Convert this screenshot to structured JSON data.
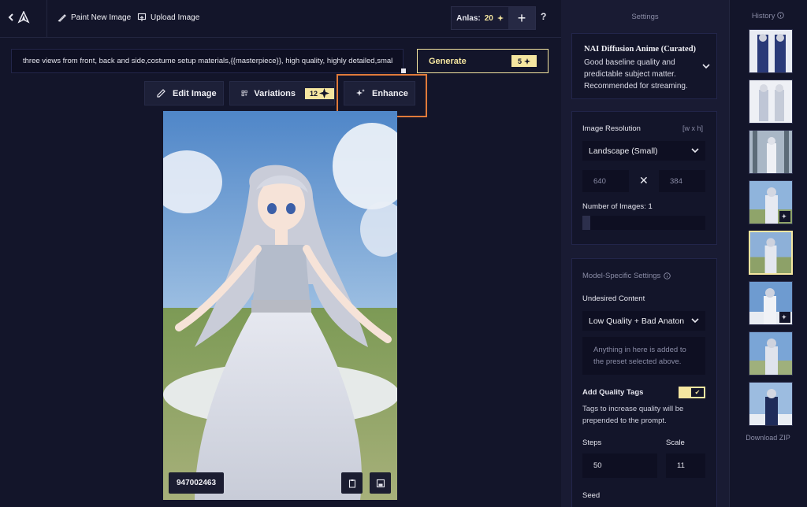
{
  "topbar": {
    "paint_label": "Paint New Image",
    "upload_label": "Upload Image",
    "anlas_label": "Anlas:",
    "anlas_count": "20",
    "plus_label": "+",
    "help_label": "?"
  },
  "prompt": {
    "value": "three views from front, back and side,costume setup materials,{{masterpiece}}, high quality, highly detailed,smal"
  },
  "generate": {
    "label": "Generate",
    "cost": "5"
  },
  "actions": {
    "edit_label": "Edit Image",
    "variations_label": "Variations",
    "variations_cost": "12",
    "enhance_label": "Enhance"
  },
  "image": {
    "seed": "947002463"
  },
  "settings": {
    "title": "Settings",
    "preset_title": "NAI Diffusion Anime (Curated)",
    "preset_desc": "Good baseline quality and predictable subject matter. Recommended for streaming.",
    "resolution_label": "Image Resolution",
    "resolution_hint": "[w x h]",
    "resolution_value": "Landscape (Small)",
    "width": "640",
    "height": "384",
    "times_symbol": "✕",
    "num_images_label": "Number of Images:",
    "num_images_value": "1",
    "model_specific_label": "Model-Specific Settings",
    "undesired_label": "Undesired Content",
    "undesired_value": "Low Quality + Bad Anaton",
    "undesired_placeholder": "Anything in here is added to the preset selected above.",
    "quality_tags_label": "Add Quality Tags",
    "quality_tags_desc": "Tags to increase quality will be prepended to the prompt.",
    "quality_tags_enabled": true,
    "steps_label": "Steps",
    "steps_value": "50",
    "scale_label": "Scale",
    "scale_value": "11",
    "seed_label": "Seed"
  },
  "history": {
    "title": "History",
    "download_label": "Download ZIP"
  },
  "colors": {
    "background": "#13152a",
    "panel": "#191b33",
    "accent": "#f5e6a0",
    "highlight": "#e07a3a"
  }
}
